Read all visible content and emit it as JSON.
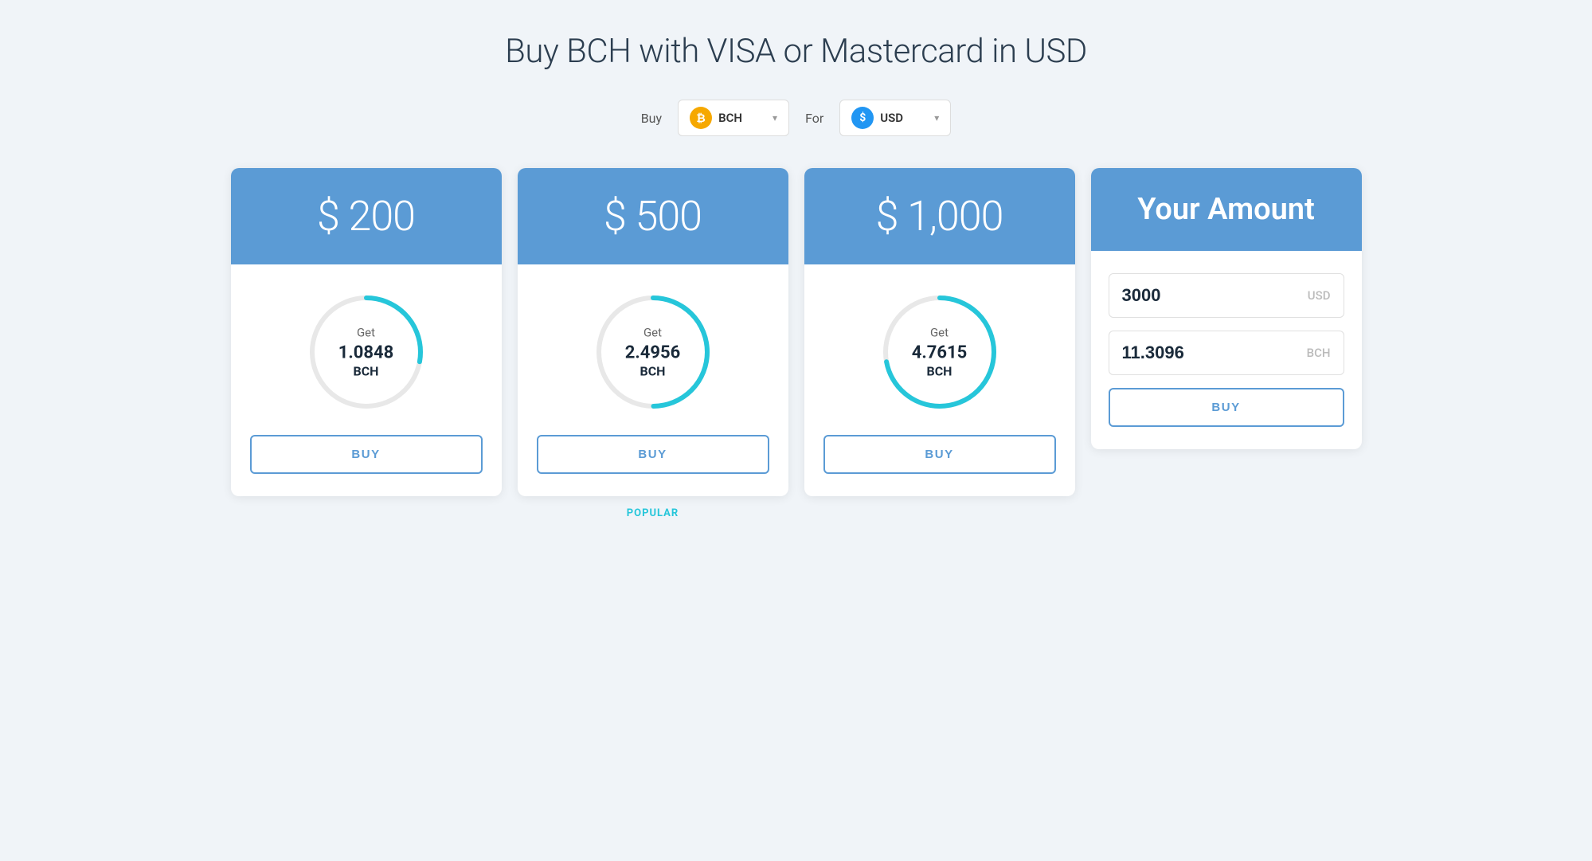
{
  "page": {
    "title": "Buy BCH with VISA or Mastercard in USD"
  },
  "selector": {
    "buy_label": "Buy",
    "for_label": "For",
    "buy_coin": "BCH",
    "for_currency": "USD"
  },
  "cards": [
    {
      "id": "card-200",
      "amount": "$ 200",
      "get_label": "Get",
      "bch_amount": "1.0848",
      "bch_unit": "BCH",
      "buy_label": "BUY",
      "popular": false,
      "progress": 0.28
    },
    {
      "id": "card-500",
      "amount": "$ 500",
      "get_label": "Get",
      "bch_amount": "2.4956",
      "bch_unit": "BCH",
      "buy_label": "BUY",
      "popular": true,
      "popular_label": "POPULAR",
      "progress": 0.5
    },
    {
      "id": "card-1000",
      "amount": "$ 1,000",
      "get_label": "Get",
      "bch_amount": "4.7615",
      "bch_unit": "BCH",
      "buy_label": "BUY",
      "popular": false,
      "progress": 0.72
    }
  ],
  "your_amount": {
    "header_title": "Your Amount",
    "usd_value": "3000",
    "usd_label": "USD",
    "bch_value": "11.3096",
    "bch_label": "BCH",
    "buy_label": "BUY"
  }
}
